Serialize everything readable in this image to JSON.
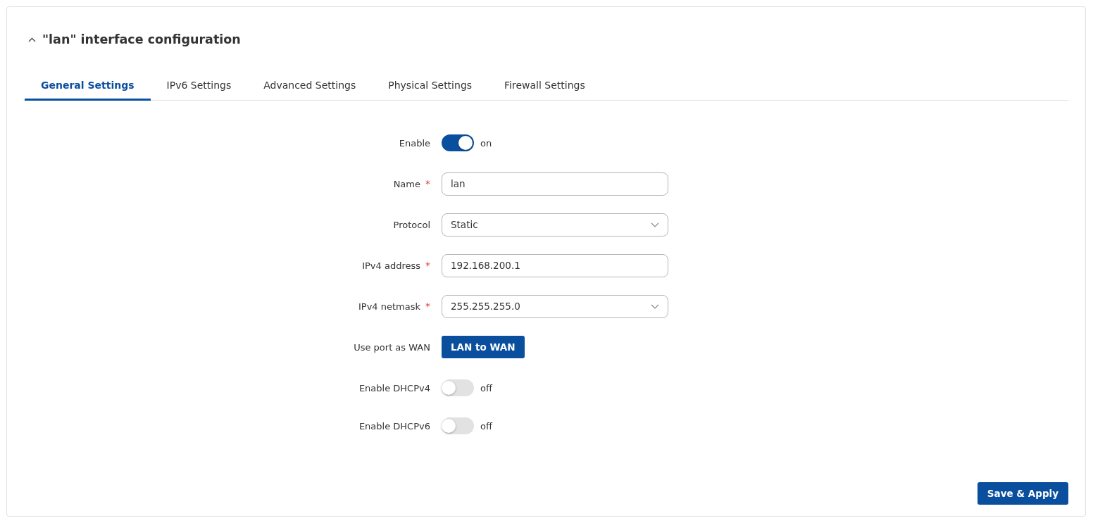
{
  "panel": {
    "title": "\"lan\" interface configuration",
    "expanded": true
  },
  "tabs": [
    {
      "label": "General Settings",
      "selected": true
    },
    {
      "label": "IPv6 Settings",
      "selected": false
    },
    {
      "label": "Advanced Settings",
      "selected": false
    },
    {
      "label": "Physical Settings",
      "selected": false
    },
    {
      "label": "Firewall Settings",
      "selected": false
    }
  ],
  "fields": [
    {
      "kind": "toggle",
      "label": "Enable",
      "on": true,
      "state_text": "on"
    },
    {
      "kind": "text",
      "label": "Name",
      "required_mark": "*",
      "value": "lan"
    },
    {
      "kind": "select",
      "label": "Protocol",
      "value": "Static"
    },
    {
      "kind": "text",
      "label": "IPv4 address",
      "required_mark": "*",
      "value": "192.168.200.1"
    },
    {
      "kind": "select",
      "label": "IPv4 netmask",
      "required_mark": "*",
      "value": "255.255.255.0"
    },
    {
      "kind": "button",
      "label": "Use port as WAN",
      "button": "LAN to WAN"
    },
    {
      "kind": "toggle",
      "label": "Enable DHCPv4",
      "on": false,
      "state_text": "off"
    },
    {
      "kind": "toggle",
      "label": "Enable DHCPv6",
      "on": false,
      "state_text": "off"
    }
  ],
  "save_button": "Save & Apply"
}
